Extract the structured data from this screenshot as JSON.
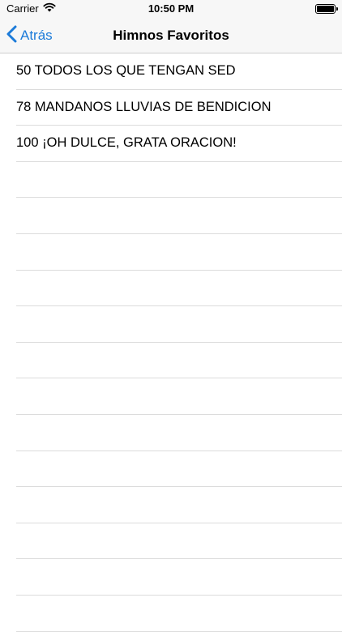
{
  "status_bar": {
    "carrier": "Carrier",
    "time": "10:50 PM"
  },
  "nav_bar": {
    "back_label": "Atrás",
    "title": "Himnos Favoritos",
    "accent_color": "#1c7bd9"
  },
  "favorites": [
    "50 TODOS LOS QUE TENGAN SED",
    "78 MANDANOS LLUVIAS DE BENDICION",
    "100 ¡OH DULCE, GRATA ORACION!"
  ]
}
